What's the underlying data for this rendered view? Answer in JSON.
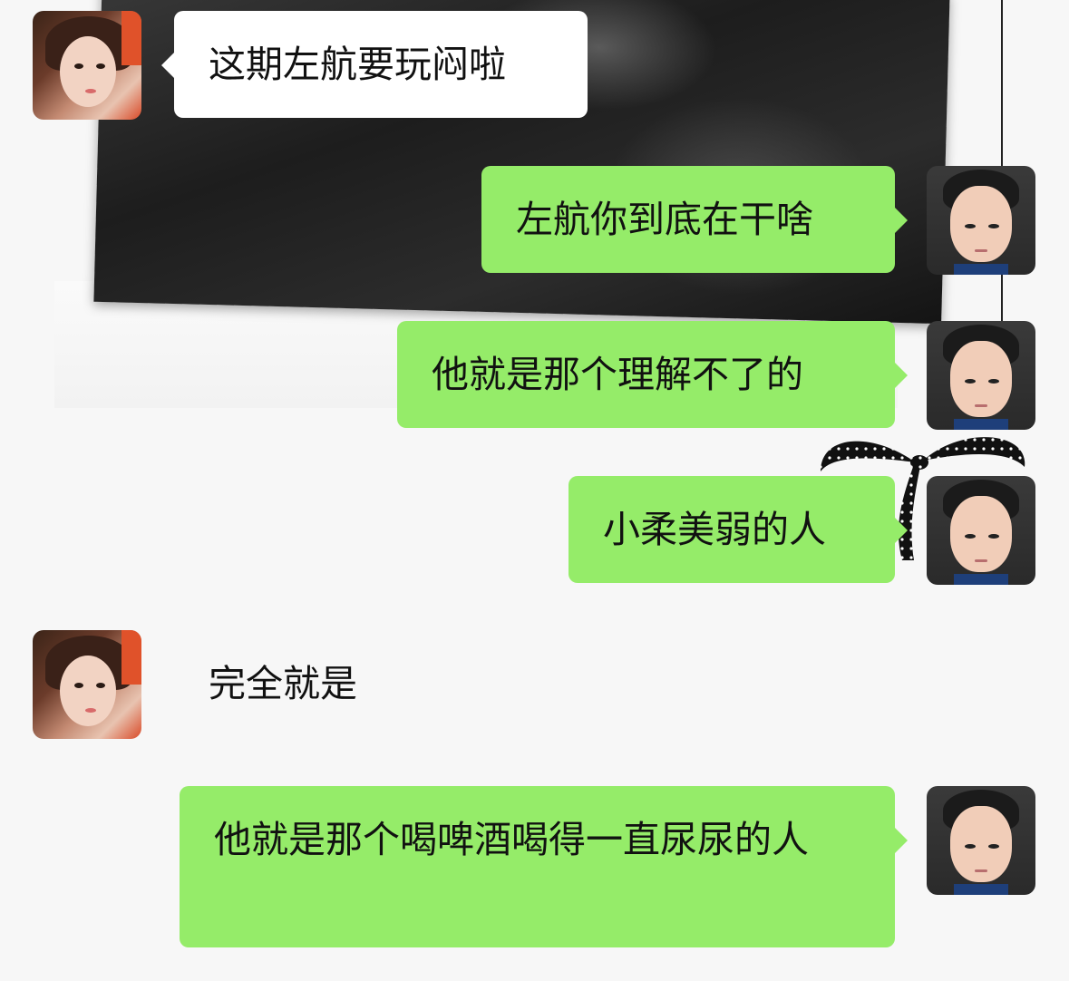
{
  "messages": [
    {
      "id": "m1",
      "sender": "girl",
      "text": "这期左航要玩闷啦"
    },
    {
      "id": "m2",
      "sender": "boy",
      "text": "左航你到底在干啥"
    },
    {
      "id": "m3",
      "sender": "boy",
      "text": "他就是那个理解不了的"
    },
    {
      "id": "m4",
      "sender": "boy",
      "text": "小柔美弱的人"
    },
    {
      "id": "m5",
      "sender": "girl",
      "text": "完全就是"
    },
    {
      "id": "m6",
      "sender": "boy",
      "text": "他就是那个喝啤酒喝得一直尿尿的人"
    }
  ],
  "colors": {
    "incoming_bubble": "#ffffff",
    "outgoing_bubble": "#95ec69",
    "background": "#f7f7f7"
  }
}
